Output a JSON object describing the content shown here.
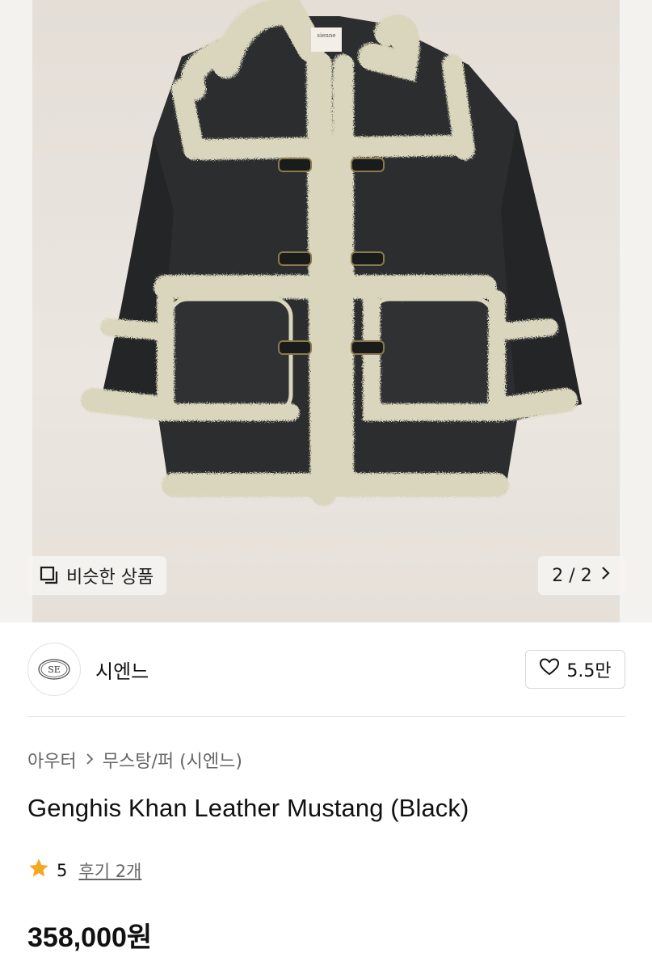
{
  "gallery": {
    "similar_label": "비슷한 상품",
    "similar_icon": "copy-icon",
    "pager_text": "2 / 2",
    "pager_icon": "chevron-right-icon",
    "jacket_label_brand": "sienne"
  },
  "brand": {
    "logo_text": "SE",
    "name": "시엔느",
    "like_icon": "heart-icon",
    "like_count": "5.5만"
  },
  "breadcrumb": {
    "category": "아우터",
    "subcategory": "무스탕/퍼 (시엔느)"
  },
  "product": {
    "title": "Genghis Khan Leather Mustang (Black)",
    "rating_value": "5",
    "rating_icon": "star-icon",
    "reviews_label": "후기 2개",
    "price": "358,000원"
  },
  "colors": {
    "star": "#f5a623",
    "jacket_leather": "#2b2d2e",
    "jacket_fur": "#d9d6bd",
    "hero_bg": "#e9e4de"
  }
}
